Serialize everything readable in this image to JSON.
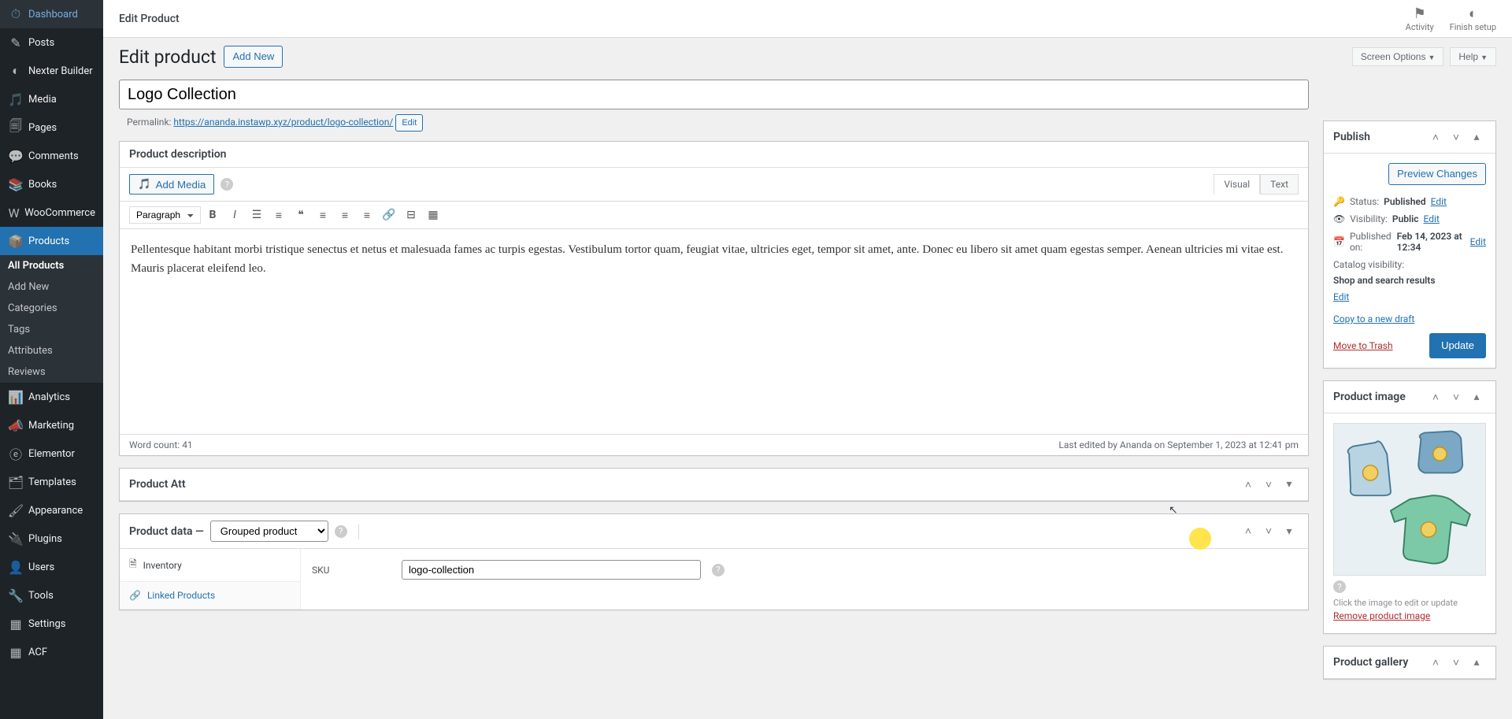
{
  "sidebar": {
    "items": [
      {
        "label": "Dashboard",
        "icon": "⌂"
      },
      {
        "label": "Posts",
        "icon": "📌"
      },
      {
        "label": "Nexter Builder",
        "icon": "◑"
      },
      {
        "label": "Media",
        "icon": "🖾"
      },
      {
        "label": "Pages",
        "icon": "🗐"
      },
      {
        "label": "Comments",
        "icon": "💬"
      },
      {
        "label": "Books",
        "icon": "📚"
      },
      {
        "label": "WooCommerce",
        "icon": "🛒"
      },
      {
        "label": "Products",
        "icon": "📦"
      },
      {
        "label": "Analytics",
        "icon": "📊"
      },
      {
        "label": "Marketing",
        "icon": "📣"
      },
      {
        "label": "Elementor",
        "icon": "ⓔ"
      },
      {
        "label": "Templates",
        "icon": "🗂"
      },
      {
        "label": "Appearance",
        "icon": "🖌"
      },
      {
        "label": "Plugins",
        "icon": "🔌"
      },
      {
        "label": "Users",
        "icon": "👤"
      },
      {
        "label": "Tools",
        "icon": "🔧"
      },
      {
        "label": "Settings",
        "icon": "⚙"
      },
      {
        "label": "ACF",
        "icon": "▦"
      }
    ],
    "submenu": [
      "All Products",
      "Add New",
      "Categories",
      "Tags",
      "Attributes",
      "Reviews"
    ]
  },
  "topbar": {
    "title": "Edit Product",
    "activity": "Activity",
    "finish_setup": "Finish setup"
  },
  "header": {
    "page_title": "Edit product",
    "add_new": "Add New",
    "screen_options": "Screen Options",
    "help": "Help"
  },
  "product": {
    "title": "Logo Collection",
    "permalink_label": "Permalink:",
    "permalink_url": "https://ananda.instawp.xyz/product/logo-collection/",
    "edit": "Edit"
  },
  "description": {
    "box_title": "Product description",
    "add_media": "Add Media",
    "tab_visual": "Visual",
    "tab_text": "Text",
    "format": "Paragraph",
    "content": "Pellentesque habitant morbi tristique senectus et netus et malesuada fames ac turpis egestas. Vestibulum tortor quam, feugiat vitae, ultricies eget, tempor sit amet, ante. Donec eu libero sit amet quam egestas semper. Aenean ultricies mi vitae est. Mauris placerat eleifend leo.",
    "word_count_label": "Word count: ",
    "word_count": "41",
    "last_edited": "Last edited by Ananda on September 1, 2023 at 12:41 pm"
  },
  "product_att": {
    "title": "Product Att"
  },
  "product_data": {
    "title": "Product data —",
    "type": "Grouped product",
    "tabs": {
      "inventory": "Inventory",
      "linked": "Linked Products"
    },
    "sku_label": "SKU",
    "sku_value": "logo-collection"
  },
  "publish": {
    "title": "Publish",
    "preview": "Preview Changes",
    "status_label": "Status:",
    "status_value": "Published",
    "visibility_label": "Visibility:",
    "visibility_value": "Public",
    "published_label": "Published on:",
    "published_value": "Feb 14, 2023 at 12:34",
    "catalog_label": "Catalog visibility:",
    "catalog_value": "Shop and search results",
    "edit": "Edit",
    "copy_draft": "Copy to a new draft",
    "trash": "Move to Trash",
    "update": "Update"
  },
  "product_image": {
    "title": "Product image",
    "hint": "Click the image to edit or update",
    "remove": "Remove product image"
  },
  "product_gallery": {
    "title": "Product gallery"
  }
}
